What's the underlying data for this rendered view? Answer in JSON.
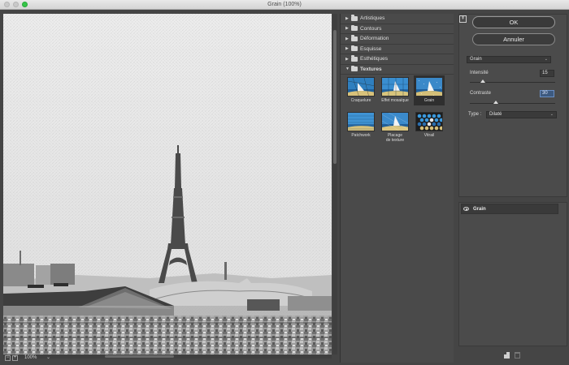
{
  "window": {
    "title": "Grain (100%)"
  },
  "preview": {
    "zoom_label": "100%"
  },
  "gallery": {
    "categories": [
      {
        "label": "Artistiques",
        "expanded": false
      },
      {
        "label": "Contours",
        "expanded": false
      },
      {
        "label": "Déformation",
        "expanded": false
      },
      {
        "label": "Esquisse",
        "expanded": false
      },
      {
        "label": "Esthétiques",
        "expanded": false
      },
      {
        "label": "Textures",
        "expanded": true
      }
    ],
    "filters": [
      {
        "label": "Craquelure",
        "selected": false
      },
      {
        "label": "Effet mosaïque",
        "selected": false
      },
      {
        "label": "Grain",
        "selected": true
      },
      {
        "label": "Patchwork",
        "selected": false
      },
      {
        "label_line1": "Placage",
        "label_line2": "de texture",
        "selected": false
      },
      {
        "label": "Vitrail",
        "selected": false
      }
    ]
  },
  "settings": {
    "ok_label": "OK",
    "cancel_label": "Annuler",
    "filter_select": "Grain",
    "intensity_label": "Intensité",
    "intensity_value": "15",
    "intensity_fraction": 0.15,
    "contrast_label": "Contraste",
    "contrast_value": "30",
    "contrast_fraction": 0.3,
    "type_label": "Type :",
    "type_value": "Dilaté"
  },
  "layers": [
    {
      "label": "Grain",
      "visible": true
    }
  ],
  "colors": {
    "accent_highlight": "#3d5a80",
    "max_button": "#35c648"
  }
}
